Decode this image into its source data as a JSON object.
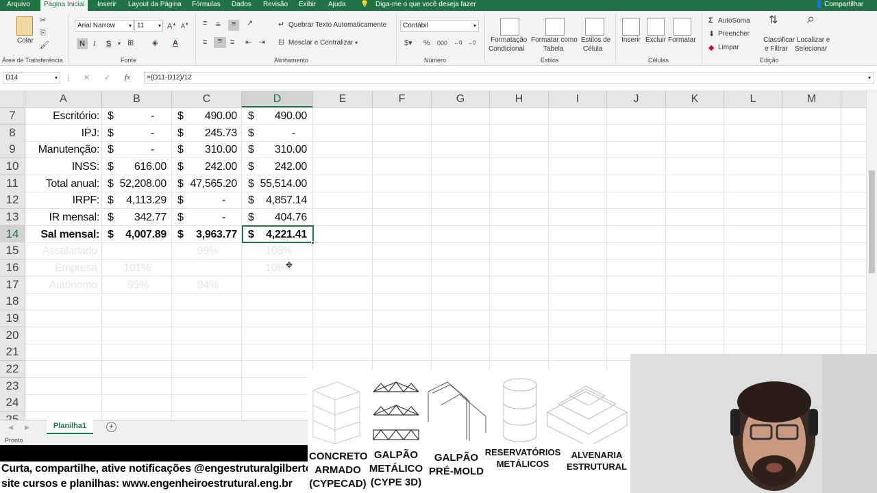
{
  "menu": {
    "tabs": [
      "Arquivo",
      "Página Inicial",
      "Inserir",
      "Layout da Página",
      "Fórmulas",
      "Dados",
      "Revisão",
      "Exibir",
      "Ajuda"
    ],
    "tell_me": "Diga-me o que você deseja fazer",
    "share": "Compartilhar"
  },
  "ribbon": {
    "paste": "Colar",
    "font_name": "Arial Narrow",
    "font_size": "11",
    "wrap_text": "Quebrar Texto Automaticamente",
    "merge_center": "Mesclar e Centralizar",
    "number_format": "Contábil",
    "cond_format": [
      "Formatação",
      "Condicional"
    ],
    "format_table": [
      "Formatar como",
      "Tabela"
    ],
    "cell_styles": [
      "Estilos de",
      "Célula"
    ],
    "insert": "Inserir",
    "delete": "Excluir",
    "format": "Formatar",
    "autosum": "AutoSoma",
    "fill": "Preencher",
    "clear": "Limpar",
    "sort_filter": [
      "Classificar",
      "e Filtrar"
    ],
    "find_select": [
      "Localizar e",
      "Selecionar"
    ],
    "groups": {
      "clipboard": "Área de Transferência",
      "font": "Fonte",
      "alignment": "Alinhamento",
      "number": "Número",
      "styles": "Estilos",
      "cells": "Células",
      "editing": "Edição"
    }
  },
  "formula_bar": {
    "name_box": "D14",
    "formula": "=(D11-D12)/12"
  },
  "columns": [
    "A",
    "B",
    "C",
    "D",
    "E",
    "F",
    "G",
    "H",
    "I",
    "J",
    "K",
    "L",
    "M"
  ],
  "rows": [
    "7",
    "8",
    "9",
    "10",
    "11",
    "12",
    "13",
    "14",
    "15",
    "16",
    "17",
    "18",
    "19",
    "20",
    "21",
    "22",
    "23",
    "24",
    "25"
  ],
  "cells": {
    "r7": {
      "a": "Escritório:",
      "b": "-",
      "c": "490.00",
      "d": "490.00"
    },
    "r8": {
      "a": "IPJ:",
      "b": "-",
      "c": "245.73",
      "d": "-"
    },
    "r9": {
      "a": "Manutenção:",
      "b": "-",
      "c": "310.00",
      "d": "310.00"
    },
    "r10": {
      "a": "INSS:",
      "b": "616.00",
      "c": "242.00",
      "d": "242.00"
    },
    "r11": {
      "a": "Total anual:",
      "b": "52,208.00",
      "c": "47,565.20",
      "d": "55,514.00"
    },
    "r12": {
      "a": "IRPF:",
      "b": "4,113.29",
      "c": "-",
      "d": "4,857.14"
    },
    "r13": {
      "a": "IR mensal:",
      "b": "342.77",
      "c": "-",
      "d": "404.76"
    },
    "r14": {
      "a": "Sal mensal:",
      "b": "4,007.89",
      "c": "3,963.77",
      "d": "4,221.41"
    },
    "r15": {
      "a": "Assalariado",
      "c": "99%",
      "d": "105%"
    },
    "r16": {
      "a": "Empresa",
      "b": "101%",
      "d": "106%"
    },
    "r17": {
      "a": "Autônomo",
      "b": "95%",
      "c": "94%"
    }
  },
  "currency": "$",
  "sheet_tab": "Planilha1",
  "status": "Pronto",
  "promo": {
    "line1": "Curta, compartilhe, ative notificações @engestruturalgilberto",
    "line2": "site cursos e planilhas: www.engenheiroestrutural.eng.br"
  },
  "courses": [
    [
      "CONCRETO",
      "ARMADO",
      "(CYPECAD)"
    ],
    [
      "GALPÃO",
      "METÁLICO",
      "(CYPE 3D)"
    ],
    [
      "GALPÃO",
      "PRÉ-MOLD"
    ],
    [
      "RESERVATÓRIOS",
      "METÁLICOS"
    ],
    [
      "ALVENARIA",
      "ESTRUTURAL"
    ]
  ],
  "colors": {
    "excel_green": "#217346"
  }
}
